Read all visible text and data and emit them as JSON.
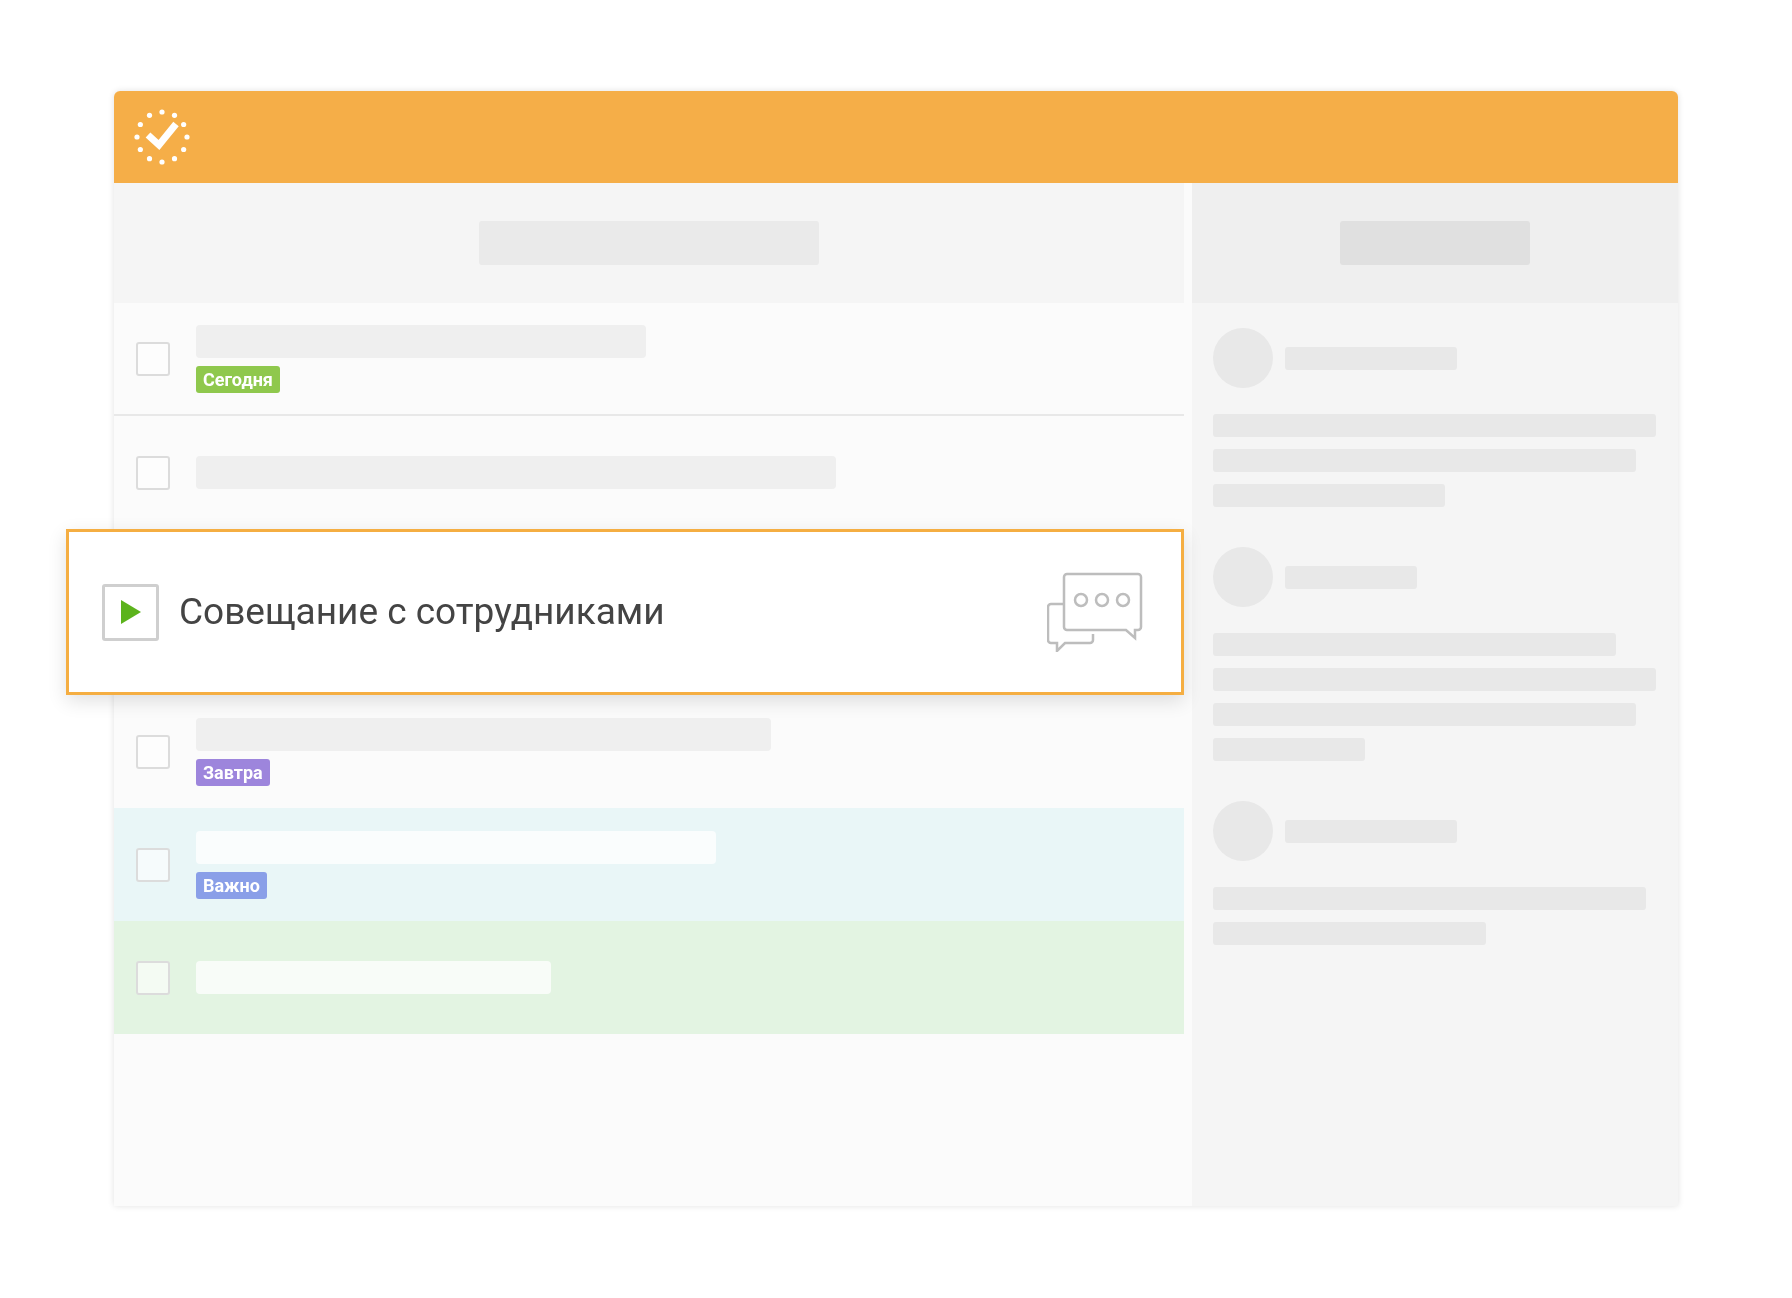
{
  "tasks": [
    {
      "kind": "row",
      "checked": false,
      "tag": {
        "label": "Сегодня",
        "color": "#8fc84d"
      }
    },
    {
      "kind": "row",
      "checked": false
    },
    {
      "kind": "active",
      "title": "Совещание с сотрудниками"
    },
    {
      "kind": "row",
      "checked": false,
      "tag": {
        "label": "Завтра",
        "color": "#9d85dc"
      }
    },
    {
      "kind": "row",
      "checked": false,
      "color": "#e9f6f7",
      "tag": {
        "label": "Важно",
        "color": "#8a9fe8"
      }
    },
    {
      "kind": "row",
      "checked": false,
      "color": "#e3f4e2"
    }
  ]
}
